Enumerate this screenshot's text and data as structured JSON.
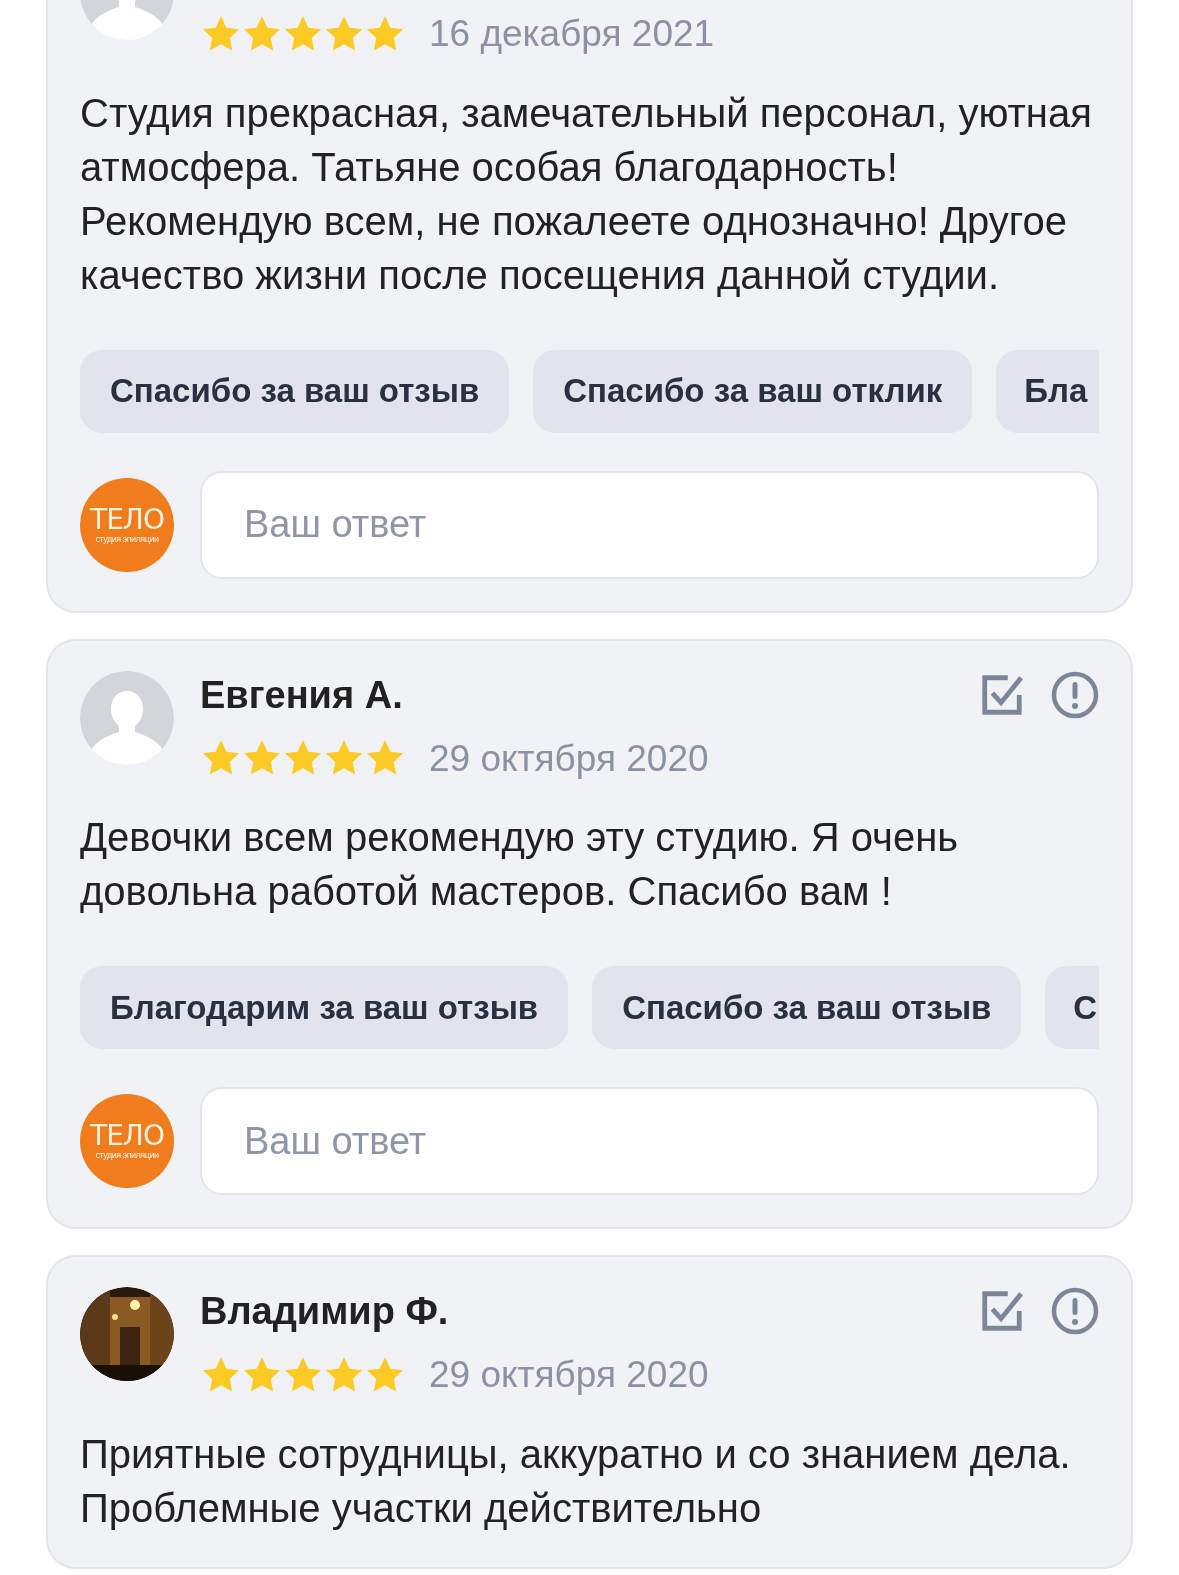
{
  "reviews": [
    {
      "avatar": {
        "kind": "placeholder"
      },
      "stars": 5,
      "date": "16 декабря 2021",
      "text": "Студия прекрасная, замечательный персонал, уютная атмосфера. Татьяне особая благодарность! Рекомендую всем, не пожалеете однозначно! Другое качество жизни после посещения данной студии.",
      "quick_replies": [
        "Спасибо за ваш отзыв",
        "Спасибо за ваш отклик",
        "Бла"
      ],
      "logo": {
        "title": "ТЕЛО",
        "subtitle": "студия эпиляции"
      },
      "reply": {
        "placeholder": "Ваш ответ"
      }
    },
    {
      "author": "Евгения А.",
      "avatar": {
        "kind": "placeholder"
      },
      "stars": 5,
      "date": "29 октября 2020",
      "text": "Девочки всем рекомендую эту студию. Я очень довольна работой мастеров. Спасибо вам !",
      "quick_replies": [
        "Благодарим за ваш отзыв",
        "Спасибо за ваш отзыв",
        "С"
      ],
      "logo": {
        "title": "ТЕЛО",
        "subtitle": "студия эпиляции"
      },
      "reply": {
        "placeholder": "Ваш ответ"
      }
    },
    {
      "author": "Владимир Ф.",
      "stars": 5,
      "date": "29 октября 2020",
      "text": "Приятные сотрудницы, аккуратно и со знанием дела. Проблемные участки действительно"
    }
  ]
}
